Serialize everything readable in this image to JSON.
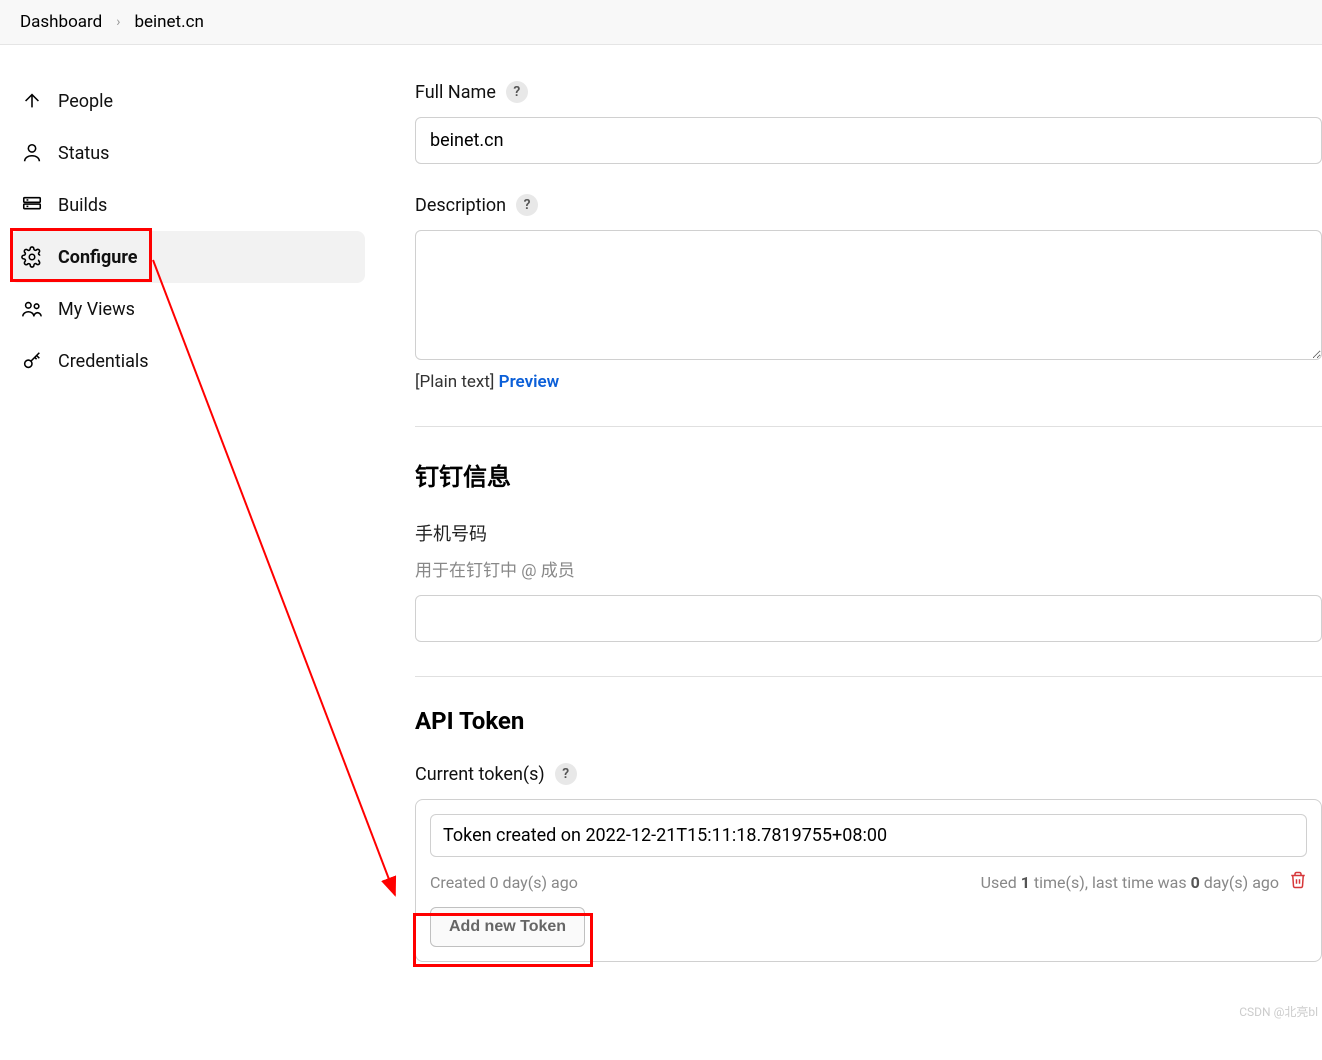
{
  "breadcrumb": {
    "items": [
      "Dashboard",
      "beinet.cn"
    ]
  },
  "sidebar": {
    "items": [
      {
        "label": "People"
      },
      {
        "label": "Status"
      },
      {
        "label": "Builds"
      },
      {
        "label": "Configure"
      },
      {
        "label": "My Views"
      },
      {
        "label": "Credentials"
      }
    ]
  },
  "main": {
    "fullName": {
      "label": "Full Name",
      "value": "beinet.cn"
    },
    "description": {
      "label": "Description",
      "value": "",
      "footer_plain": "[Plain text]",
      "footer_preview": "Preview"
    },
    "dingding": {
      "title": "钉钉信息",
      "phone_label": "手机号码",
      "phone_desc": "用于在钉钉中 @ 成员",
      "phone_value": ""
    },
    "api_token": {
      "title": "API Token",
      "current_label": "Current token(s)",
      "token_name": "Token created on 2022-12-21T15:11:18.7819755+08:00",
      "created_text": "Created 0 day(s) ago",
      "used_prefix": "Used ",
      "used_count": "1",
      "used_mid": " time(s), last time was ",
      "used_days": "0",
      "used_suffix": " day(s) ago",
      "add_button": "Add new Token"
    }
  },
  "watermark": "CSDN @北亮bl"
}
